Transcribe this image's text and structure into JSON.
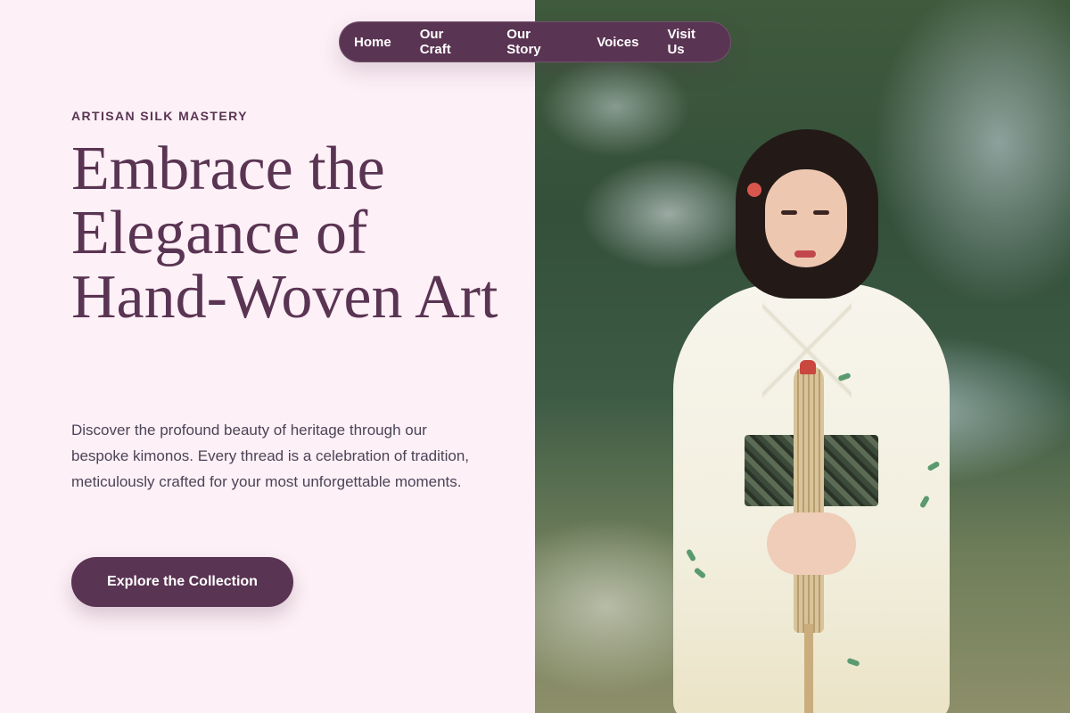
{
  "nav": {
    "items": [
      {
        "label": "Home"
      },
      {
        "label": "Our Craft"
      },
      {
        "label": "Our Story"
      },
      {
        "label": "Voices"
      },
      {
        "label": "Visit Us"
      }
    ]
  },
  "hero": {
    "eyebrow": "ARTISAN SILK MASTERY",
    "title": "Embrace the Elegance of Hand-Woven Art",
    "description": "Discover the profound beauty of heritage through our bespoke kimonos. Every thread is a celebration of tradition, meticulously crafted for your most unforgettable moments.",
    "cta_label": "Explore the Collection"
  },
  "colors": {
    "accent": "#5a3453",
    "background": "#fdf0f6",
    "body_text": "#4b4458"
  }
}
